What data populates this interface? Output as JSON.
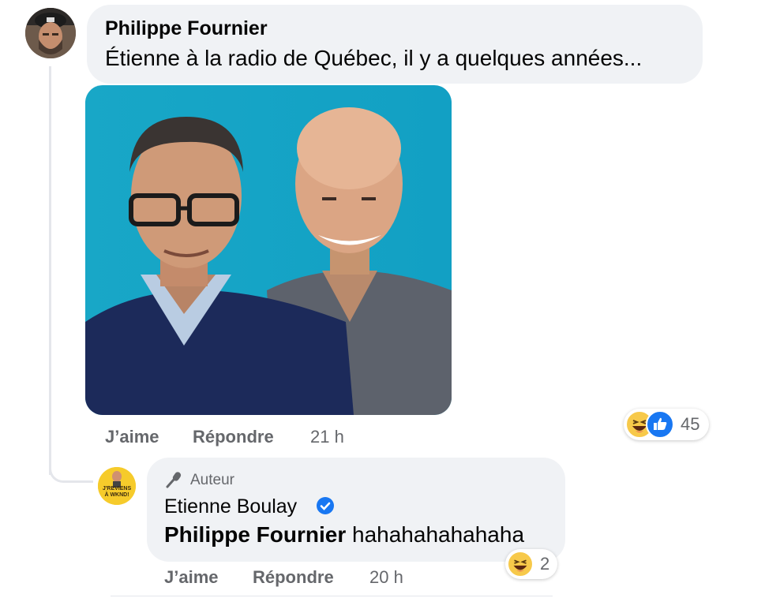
{
  "comment": {
    "author": "Philippe Fournier",
    "text": "Étienne à la radio de Québec, il y a quelques années...",
    "actions": {
      "like": "J’aime",
      "reply": "Répondre",
      "time": "21 h"
    },
    "reaction_count": "45",
    "reaction_icons": [
      "haha-icon",
      "like-icon"
    ]
  },
  "reply": {
    "badge": "Auteur",
    "author": "Etienne Boulay",
    "verified": true,
    "mention": "Philippe Fournier",
    "text": "hahahahahahaha",
    "actions": {
      "like": "J’aime",
      "reply": "Répondre",
      "time": "20 h"
    },
    "reaction_count": "2",
    "reaction_icons": [
      "haha-icon"
    ],
    "avatar_text": [
      "J'REVIENS",
      "À WKND!"
    ]
  },
  "colors": {
    "bubble": "#f0f2f5",
    "meta": "#65676b",
    "verified": "#1877f2",
    "photo_bg": "#1aa5c4"
  }
}
